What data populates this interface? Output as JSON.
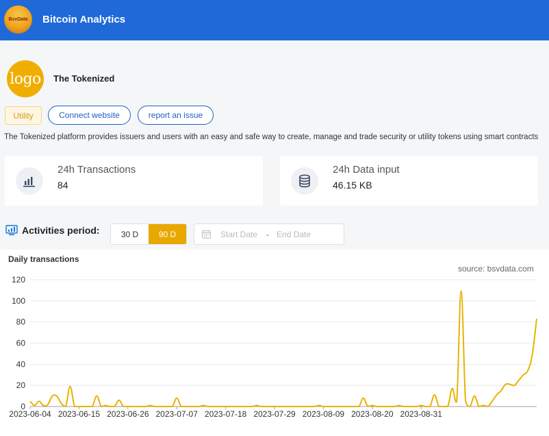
{
  "header": {
    "brand_logo_text": "BsvData",
    "title": "Bitcoin Analytics"
  },
  "app": {
    "logo_text": "logo",
    "name": "The Tokenized",
    "tag": "Utility",
    "connect_label": "Connect website",
    "report_label": "report an issue",
    "description": "The Tokenized platform provides issuers and users with an easy and safe way to create, manage and trade security or utility tokens using smart contracts"
  },
  "stats": [
    {
      "label": "24h Transactions",
      "value": "84",
      "icon": "bar-chart-icon"
    },
    {
      "label": "24h Data input",
      "value": "46.15 KB",
      "icon": "database-icon"
    }
  ],
  "activities": {
    "title": "Activities period:",
    "periods": [
      "30 D",
      "90 D"
    ],
    "active_period": "90 D",
    "start_placeholder": "Start Date",
    "separator": "-",
    "end_placeholder": "End Date"
  },
  "colors": {
    "header": "#1f6ad8",
    "accent": "#e8a800",
    "line": "#e8b200",
    "link": "#1f5fc5"
  },
  "chart_data": {
    "type": "line",
    "title": "Daily transactions",
    "source": "source: bsvdata.com",
    "ylim": [
      0,
      120
    ],
    "yticks": [
      0,
      20,
      40,
      60,
      80,
      100,
      120
    ],
    "xticks": [
      "2023-06-04",
      "2023-06-15",
      "2023-06-26",
      "2023-07-07",
      "2023-07-18",
      "2023-07-29",
      "2023-08-09",
      "2023-08-20",
      "2023-08-31"
    ],
    "x_start": "2023-06-04",
    "series": [
      {
        "values": [
          5,
          1,
          5,
          1,
          2,
          10,
          10,
          3,
          0,
          19,
          0,
          0,
          0,
          0,
          0,
          10,
          0,
          1,
          0,
          0,
          6,
          0,
          0,
          0,
          0,
          0,
          0,
          1,
          0,
          0,
          0,
          0,
          0,
          8,
          0,
          0,
          0,
          0,
          0,
          1,
          0,
          0,
          0,
          0,
          0,
          0,
          0,
          0,
          0,
          0,
          0,
          1,
          0,
          0,
          0,
          0,
          0,
          0,
          0,
          0,
          0,
          0,
          0,
          0,
          0,
          1,
          0,
          0,
          0,
          0,
          0,
          0,
          0,
          0,
          0,
          8,
          0,
          1,
          0,
          0,
          0,
          0,
          0,
          1,
          0,
          0,
          0,
          0,
          1,
          0,
          0,
          11,
          0,
          0,
          0,
          17,
          5,
          109,
          5,
          0,
          10,
          0,
          1,
          0,
          5,
          11,
          15,
          21,
          21,
          20,
          25,
          30,
          34,
          49,
          83
        ]
      }
    ]
  }
}
